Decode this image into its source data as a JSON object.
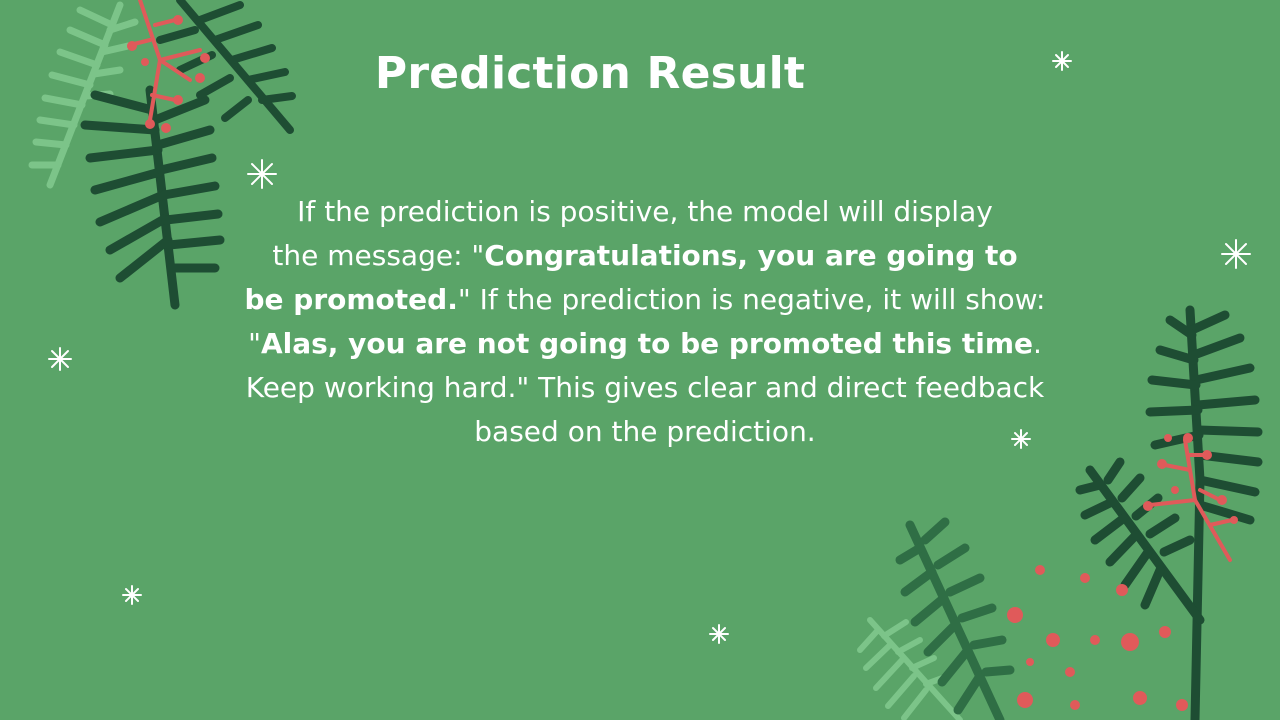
{
  "slide": {
    "title": "Prediction Result",
    "paragraph": {
      "line1": "If the prediction is positive, the model will display",
      "line2_prefix": "the message: \"",
      "line2_bold": "Congratulations, you are going to",
      "line3_bold": "be promoted.",
      "line3_rest": "\" If the prediction is negative, it will show:",
      "line4_quote": "\"",
      "line4_bold": "Alas, you are not going to be promoted this time",
      "line4_end": ".",
      "line5": "Keep working hard.\" This gives clear and direct feedback",
      "line6": "based on the prediction."
    }
  },
  "colors": {
    "background": "#5aa468",
    "text": "#ffffff",
    "dark_leaf": "#1e4d33",
    "mid_leaf": "#2f6e45",
    "light_leaf": "#7cc489",
    "berry": "#e05a5a"
  },
  "decorations": {
    "top_left": "pine-branch-with-berries",
    "bottom_right": "pine-branch-with-berries",
    "sparkles": "sparkle-icon"
  }
}
